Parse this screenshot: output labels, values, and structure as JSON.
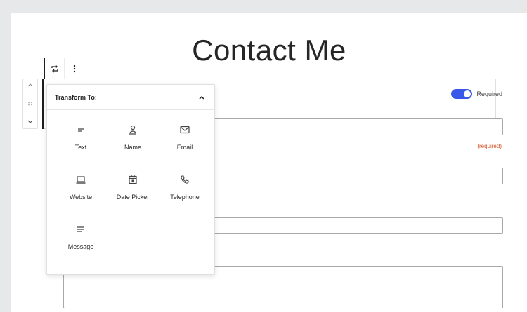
{
  "page": {
    "title": "Contact Me"
  },
  "toolbar": {
    "transform_icon": "transform-icon",
    "options_icon": "more-vertical-icon"
  },
  "mover": {
    "up": "^",
    "drag": "::",
    "down": "v"
  },
  "field": {
    "required_toggle_on": true,
    "required_label": "Required",
    "required_hint": "(required)"
  },
  "transform": {
    "title": "Transform To:",
    "items": [
      {
        "label": "Text",
        "icon": "text-lines-icon"
      },
      {
        "label": "Name",
        "icon": "person-icon"
      },
      {
        "label": "Email",
        "icon": "envelope-icon"
      },
      {
        "label": "Website",
        "icon": "laptop-icon"
      },
      {
        "label": "Date Picker",
        "icon": "calendar-icon"
      },
      {
        "label": "Telephone",
        "icon": "phone-icon"
      },
      {
        "label": "Message",
        "icon": "paragraph-icon"
      }
    ]
  },
  "colors": {
    "accent": "#3858e9",
    "required_hint": "#d4552b"
  }
}
